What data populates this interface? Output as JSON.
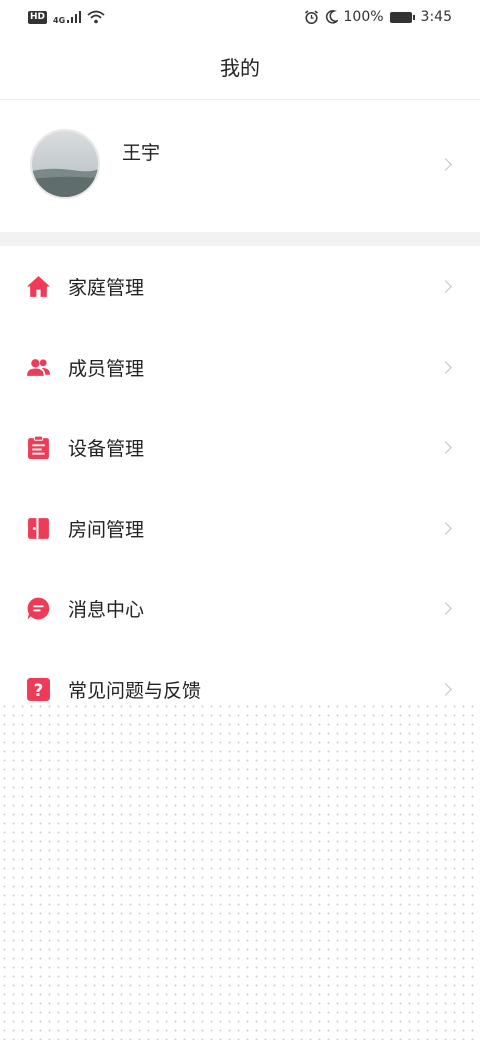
{
  "status_bar": {
    "hd": "HD",
    "network": "4G",
    "battery_percent": "100%",
    "time": "3:45"
  },
  "header": {
    "title": "我的"
  },
  "profile": {
    "name": "王宇"
  },
  "menu": {
    "items": [
      {
        "label": "家庭管理",
        "icon": "home-icon"
      },
      {
        "label": "成员管理",
        "icon": "members-icon"
      },
      {
        "label": "设备管理",
        "icon": "clipboard-icon"
      },
      {
        "label": "房间管理",
        "icon": "door-icon"
      },
      {
        "label": "消息中心",
        "icon": "message-icon"
      },
      {
        "label": "常见问题与反馈",
        "icon": "question-icon"
      }
    ]
  },
  "colors": {
    "accent": "#ee3b57",
    "divider": "#f2f2f2",
    "text": "#222222",
    "chevron": "#c4c4c4"
  }
}
